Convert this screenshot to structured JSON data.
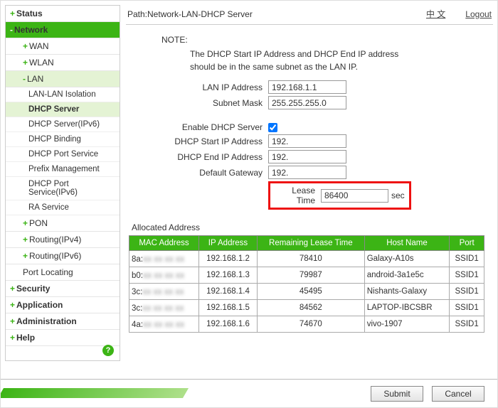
{
  "path": "Path:Network-LAN-DHCP Server",
  "lang": "中 文",
  "logout": "Logout",
  "sidebar": {
    "status": "Status",
    "network": "Network",
    "wan": "WAN",
    "wlan": "WLAN",
    "lan": "LAN",
    "lan_items": [
      "LAN-LAN Isolation",
      "DHCP Server",
      "DHCP Server(IPv6)",
      "DHCP Binding",
      "DHCP Port Service",
      "Prefix Management",
      "DHCP Port Service(IPv6)",
      "RA Service"
    ],
    "pon": "PON",
    "routing4": "Routing(IPv4)",
    "routing6": "Routing(IPv6)",
    "portloc": "Port Locating",
    "security": "Security",
    "application": "Application",
    "administration": "Administration",
    "help": "Help"
  },
  "note": {
    "h": "NOTE:",
    "t": "The DHCP Start IP Address and DHCP End IP address should be in the same subnet as the LAN IP."
  },
  "form": {
    "lan_ip_l": "LAN IP Address",
    "lan_ip": "192.168.1.1",
    "mask_l": "Subnet Mask",
    "mask": "255.255.255.0",
    "enable_l": "Enable DHCP Server",
    "start_l": "DHCP Start IP Address",
    "start": "192.",
    "end_l": "DHCP End IP Address",
    "end": "192.",
    "gw_l": "Default Gateway",
    "gw": "192.",
    "lease_l": "Lease Time",
    "lease": "86400",
    "sec": "sec"
  },
  "alloc": {
    "title": "Allocated Address",
    "cols": [
      "MAC Address",
      "IP Address",
      "Remaining Lease Time",
      "Host Name",
      "Port"
    ],
    "rows": [
      {
        "mac": "8a:",
        "ip": "192.168.1.2",
        "rl": "78410",
        "host": "Galaxy-A10s",
        "port": "SSID1"
      },
      {
        "mac": "b0:",
        "ip": "192.168.1.3",
        "rl": "79987",
        "host": "android-3a1e5c",
        "port": "SSID1"
      },
      {
        "mac": "3c:",
        "ip": "192.168.1.4",
        "rl": "45495",
        "host": "Nishants-Galaxy",
        "port": "SSID1"
      },
      {
        "mac": "3c:",
        "ip": "192.168.1.5",
        "rl": "84562",
        "host": "LAPTOP-IBCSBR",
        "port": "SSID1"
      },
      {
        "mac": "4a:",
        "ip": "192.168.1.6",
        "rl": "74670",
        "host": "vivo-1907",
        "port": "SSID1"
      }
    ]
  },
  "buttons": {
    "submit": "Submit",
    "cancel": "Cancel"
  }
}
